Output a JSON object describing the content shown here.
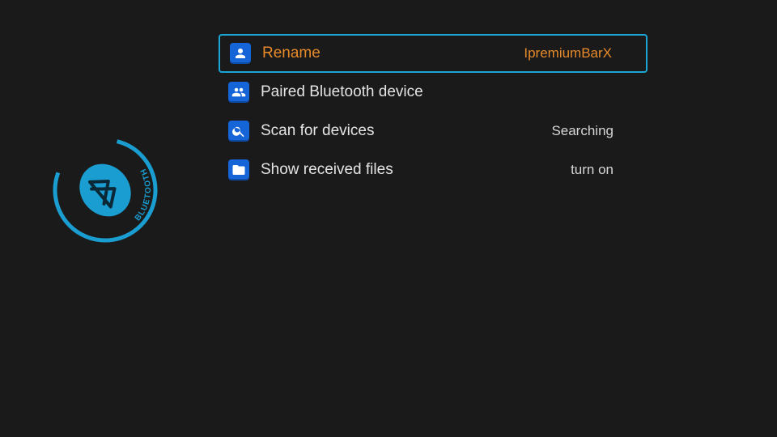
{
  "sidebar": {
    "caption": "BLUETOOTH"
  },
  "menu": {
    "items": [
      {
        "label": "Rename",
        "value": "IpremiumBarX",
        "selected": true
      },
      {
        "label": "Paired Bluetooth device",
        "value": ""
      },
      {
        "label": "Scan for devices",
        "value": "Searching"
      },
      {
        "label": "Show received files",
        "value": "turn on"
      }
    ]
  }
}
